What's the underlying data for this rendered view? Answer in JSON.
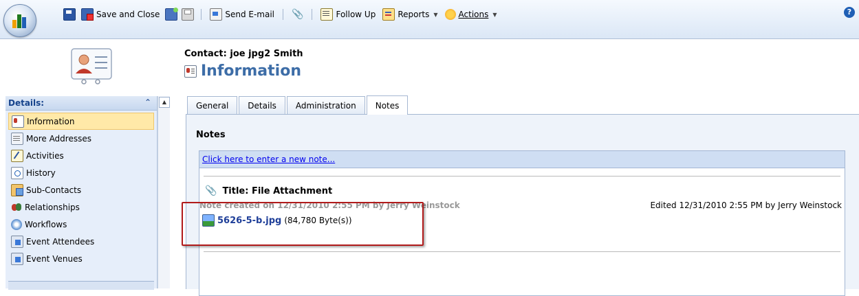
{
  "toolbar": {
    "save_and_close": "Save and Close",
    "send_email": "Send E-mail",
    "follow_up": "Follow Up",
    "reports": "Reports",
    "actions": "Actions",
    "help_glyph": "?"
  },
  "header": {
    "contact_label": "Contact: joe jpg2 Smith",
    "page_title": "Information"
  },
  "leftnav": {
    "section_title": "Details:",
    "items": [
      {
        "label": "Information",
        "icon": "contact-card-icon"
      },
      {
        "label": "More Addresses",
        "icon": "addresses-icon"
      },
      {
        "label": "Activities",
        "icon": "activities-icon"
      },
      {
        "label": "History",
        "icon": "history-icon"
      },
      {
        "label": "Sub-Contacts",
        "icon": "sub-contacts-icon"
      },
      {
        "label": "Relationships",
        "icon": "relationships-icon"
      },
      {
        "label": "Workflows",
        "icon": "workflows-icon"
      },
      {
        "label": "Event Attendees",
        "icon": "event-attendees-icon"
      },
      {
        "label": "Event Venues",
        "icon": "event-venues-icon"
      }
    ]
  },
  "tabs": [
    {
      "label": "General"
    },
    {
      "label": "Details"
    },
    {
      "label": "Administration"
    },
    {
      "label": "Notes",
      "active": true
    }
  ],
  "notes": {
    "section_title": "Notes",
    "new_note_link": "Click here to enter a new note...",
    "note_title": "Title: File Attachment",
    "created": "Note created on 12/31/2010 2:55 PM by Jerry Weinstock",
    "edited": "Edited 12/31/2010 2:55 PM by Jerry Weinstock",
    "attachment_name": "5626-5-b.jpg",
    "attachment_size": "(84,780 Byte(s))"
  },
  "colors": {
    "accent": "#3d6da7",
    "highlight_border": "#b11a1a"
  }
}
